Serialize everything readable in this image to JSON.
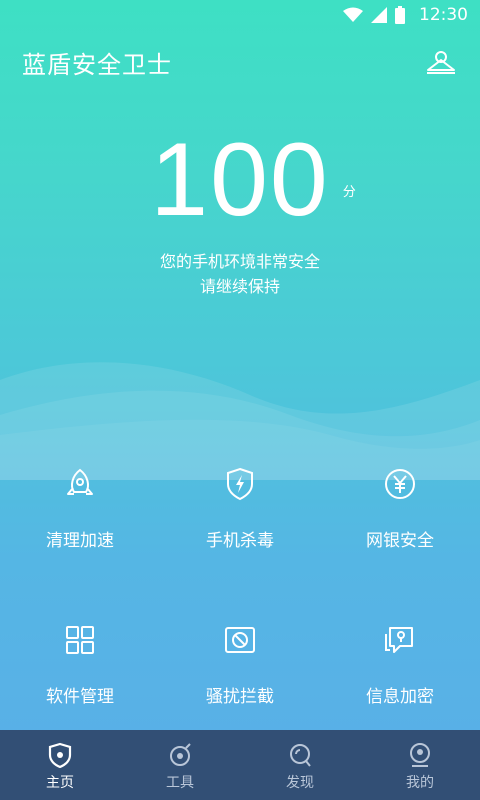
{
  "status_bar": {
    "time": "12:30"
  },
  "header": {
    "title": "蓝盾安全卫士",
    "profile_icon": "profile-icon"
  },
  "score": {
    "value": "100",
    "unit": "分",
    "message_line1": "您的手机环境非常安全",
    "message_line2": "请继续保持"
  },
  "features": [
    {
      "label": "清理加速",
      "icon": "rocket-icon"
    },
    {
      "label": "手机杀毒",
      "icon": "shield-bolt-icon"
    },
    {
      "label": "网银安全",
      "icon": "yuan-icon"
    },
    {
      "label": "软件管理",
      "icon": "apps-grid-icon"
    },
    {
      "label": "骚扰拦截",
      "icon": "block-icon"
    },
    {
      "label": "信息加密",
      "icon": "message-lock-icon"
    }
  ],
  "tabs": [
    {
      "label": "主页",
      "icon": "home-shield-icon",
      "active": true
    },
    {
      "label": "工具",
      "icon": "tools-icon",
      "active": false
    },
    {
      "label": "发现",
      "icon": "discover-icon",
      "active": false
    },
    {
      "label": "我的",
      "icon": "me-icon",
      "active": false
    }
  ],
  "colors": {
    "gradient_top": "#3ee0c4",
    "gradient_bottom": "#5aaee8",
    "tabbar_bg": "#324f75"
  }
}
